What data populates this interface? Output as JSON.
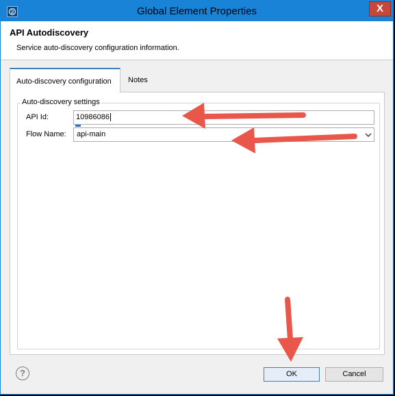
{
  "window": {
    "title": "Global Element Properties",
    "close_glyph": "X",
    "title_bar_color": "#1883d7"
  },
  "banner": {
    "title": "API Autodiscovery",
    "description": "Service auto-discovery configuration information."
  },
  "tabs": [
    {
      "label": "Auto-discovery configuration",
      "active": true
    },
    {
      "label": "Notes",
      "active": false
    }
  ],
  "group": {
    "legend": "Auto-discovery settings",
    "api_id": {
      "label": "API Id:",
      "value": "10986086",
      "info_glyph": "i"
    },
    "flow_name": {
      "label": "Flow Name:",
      "value": "api-main"
    }
  },
  "buttons": {
    "help_glyph": "?",
    "ok_label": "OK",
    "cancel_label": "Cancel"
  },
  "annotation_color": "#e8574a"
}
